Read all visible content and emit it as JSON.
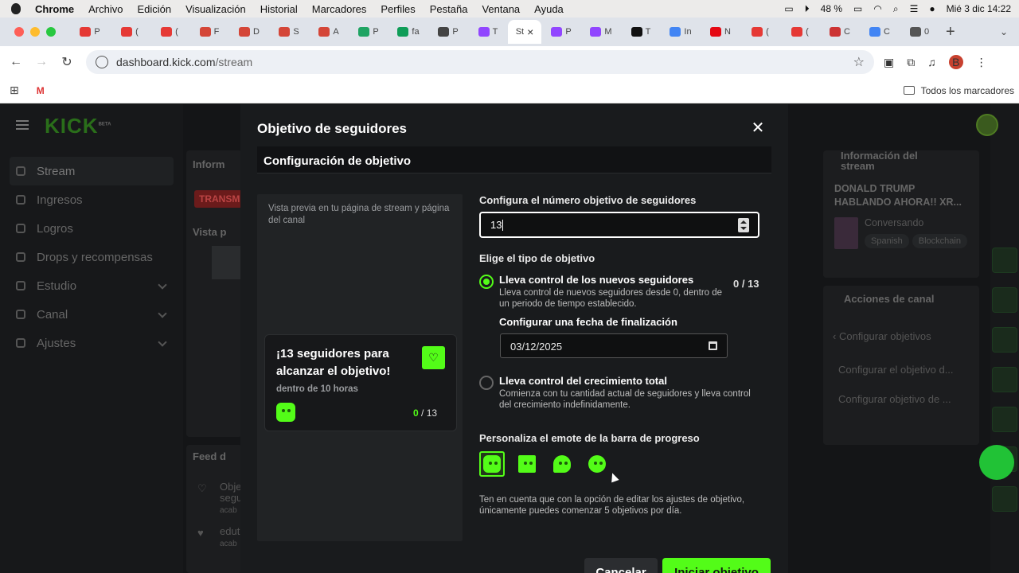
{
  "macos": {
    "app": "Chrome",
    "menu": [
      "Archivo",
      "Edición",
      "Visualización",
      "Historial",
      "Marcadores",
      "Perfiles",
      "Pestaña",
      "Ventana",
      "Ayuda"
    ],
    "battery": "48 %",
    "clock": "Mié 3 dic 14:22"
  },
  "browser": {
    "tabs": [
      {
        "label": "P",
        "color": "#e53935"
      },
      {
        "label": "(",
        "color": "#e53935"
      },
      {
        "label": "(",
        "color": "#e53935"
      },
      {
        "label": "F",
        "color": "#d44638"
      },
      {
        "label": "D",
        "color": "#d44638"
      },
      {
        "label": "S",
        "color": "#d44638"
      },
      {
        "label": "A",
        "color": "#d44638"
      },
      {
        "label": "P",
        "color": "#1fa463"
      },
      {
        "label": "fa",
        "color": "#0f9d58"
      },
      {
        "label": "P",
        "color": "#444444"
      },
      {
        "label": "T",
        "color": "#9146ff"
      },
      {
        "label": "St",
        "color": "#ffffff",
        "active": true
      },
      {
        "label": "P",
        "color": "#9146ff"
      },
      {
        "label": "M",
        "color": "#9146ff"
      },
      {
        "label": "T",
        "color": "#111111"
      },
      {
        "label": "In",
        "color": "#4285f4"
      },
      {
        "label": "N",
        "color": "#e50914"
      },
      {
        "label": "(",
        "color": "#e53935"
      },
      {
        "label": "(",
        "color": "#e53935"
      },
      {
        "label": "C",
        "color": "#cc3333"
      },
      {
        "label": "C",
        "color": "#4285f4"
      },
      {
        "label": "0",
        "color": "#555555"
      }
    ],
    "url_host": "dashboard.kick.com",
    "url_path": "/stream",
    "profile_initial": "B",
    "bookmarks_all": "Todos los marcadores"
  },
  "dashboard": {
    "logo": "KICK",
    "logo_badge": "BETA",
    "nav": [
      {
        "label": "Stream",
        "active": true
      },
      {
        "label": "Ingresos"
      },
      {
        "label": "Logros"
      },
      {
        "label": "Drops y recompensas"
      },
      {
        "label": "Estudio",
        "chevron": true
      },
      {
        "label": "Canal",
        "chevron": true
      },
      {
        "label": "Ajustes",
        "chevron": true
      }
    ],
    "info_title": "Inform",
    "live_badge": "TRANSMI",
    "preview_title": "Vista p",
    "feed_title": "Feed d",
    "feed_items": [
      "Obje",
      "segu",
      "acab",
      "edut",
      "acab",
      "Obje"
    ],
    "stream_info_title": "Información del stream",
    "stream_title": "DONALD TRUMP HABLANDO AHORA!! XR...",
    "category": "Conversando",
    "tags": [
      "Spanish",
      "Blockchain"
    ],
    "actions_title": "Acciones de canal",
    "actions_back": "Configurar objetivos",
    "actions_links": [
      "Configurar el objetivo d...",
      "Configurar objetivo de ..."
    ]
  },
  "modal": {
    "title": "Objetivo de seguidores",
    "section": "Configuración de objetivo",
    "preview_note": "Vista previa en tu página de stream y página del canal",
    "card": {
      "title": "¡13 seguidores para alcanzar el objetivo!",
      "subtitle": "dentro de 10 horas",
      "current": "0",
      "target": "/ 13"
    },
    "target_label": "Configura el número objetivo de seguidores",
    "target_value": "13",
    "type_label": "Elige el tipo de objetivo",
    "option1": {
      "title": "Lleva control de los nuevos seguidores",
      "desc": "Lleva control de nuevos seguidores desde 0, dentro de un periodo de tiempo establecido.",
      "count": "0 / 13",
      "selected": true
    },
    "end_date_label": "Configurar una fecha de finalización",
    "end_date_value": "03/12/2025",
    "option2": {
      "title": "Lleva control del crecimiento total",
      "desc": "Comienza con tu cantidad actual de seguidores y lleva control del crecimiento indefinidamente.",
      "selected": false
    },
    "emote_label": "Personaliza el emote de la barra de progreso",
    "emotes": [
      "emote-1-icon",
      "emote-2-icon",
      "emote-3-icon",
      "emote-4-icon"
    ],
    "selected_emote": 0,
    "footnote": "Ten en cuenta que con la opción de editar los ajustes de objetivo, únicamente puedes comenzar 5 objetivos por día.",
    "cancel": "Cancelar",
    "start": "Iniciar objetivo"
  },
  "colors": {
    "accent": "#53fc18",
    "modal_bg": "#191b1d"
  }
}
